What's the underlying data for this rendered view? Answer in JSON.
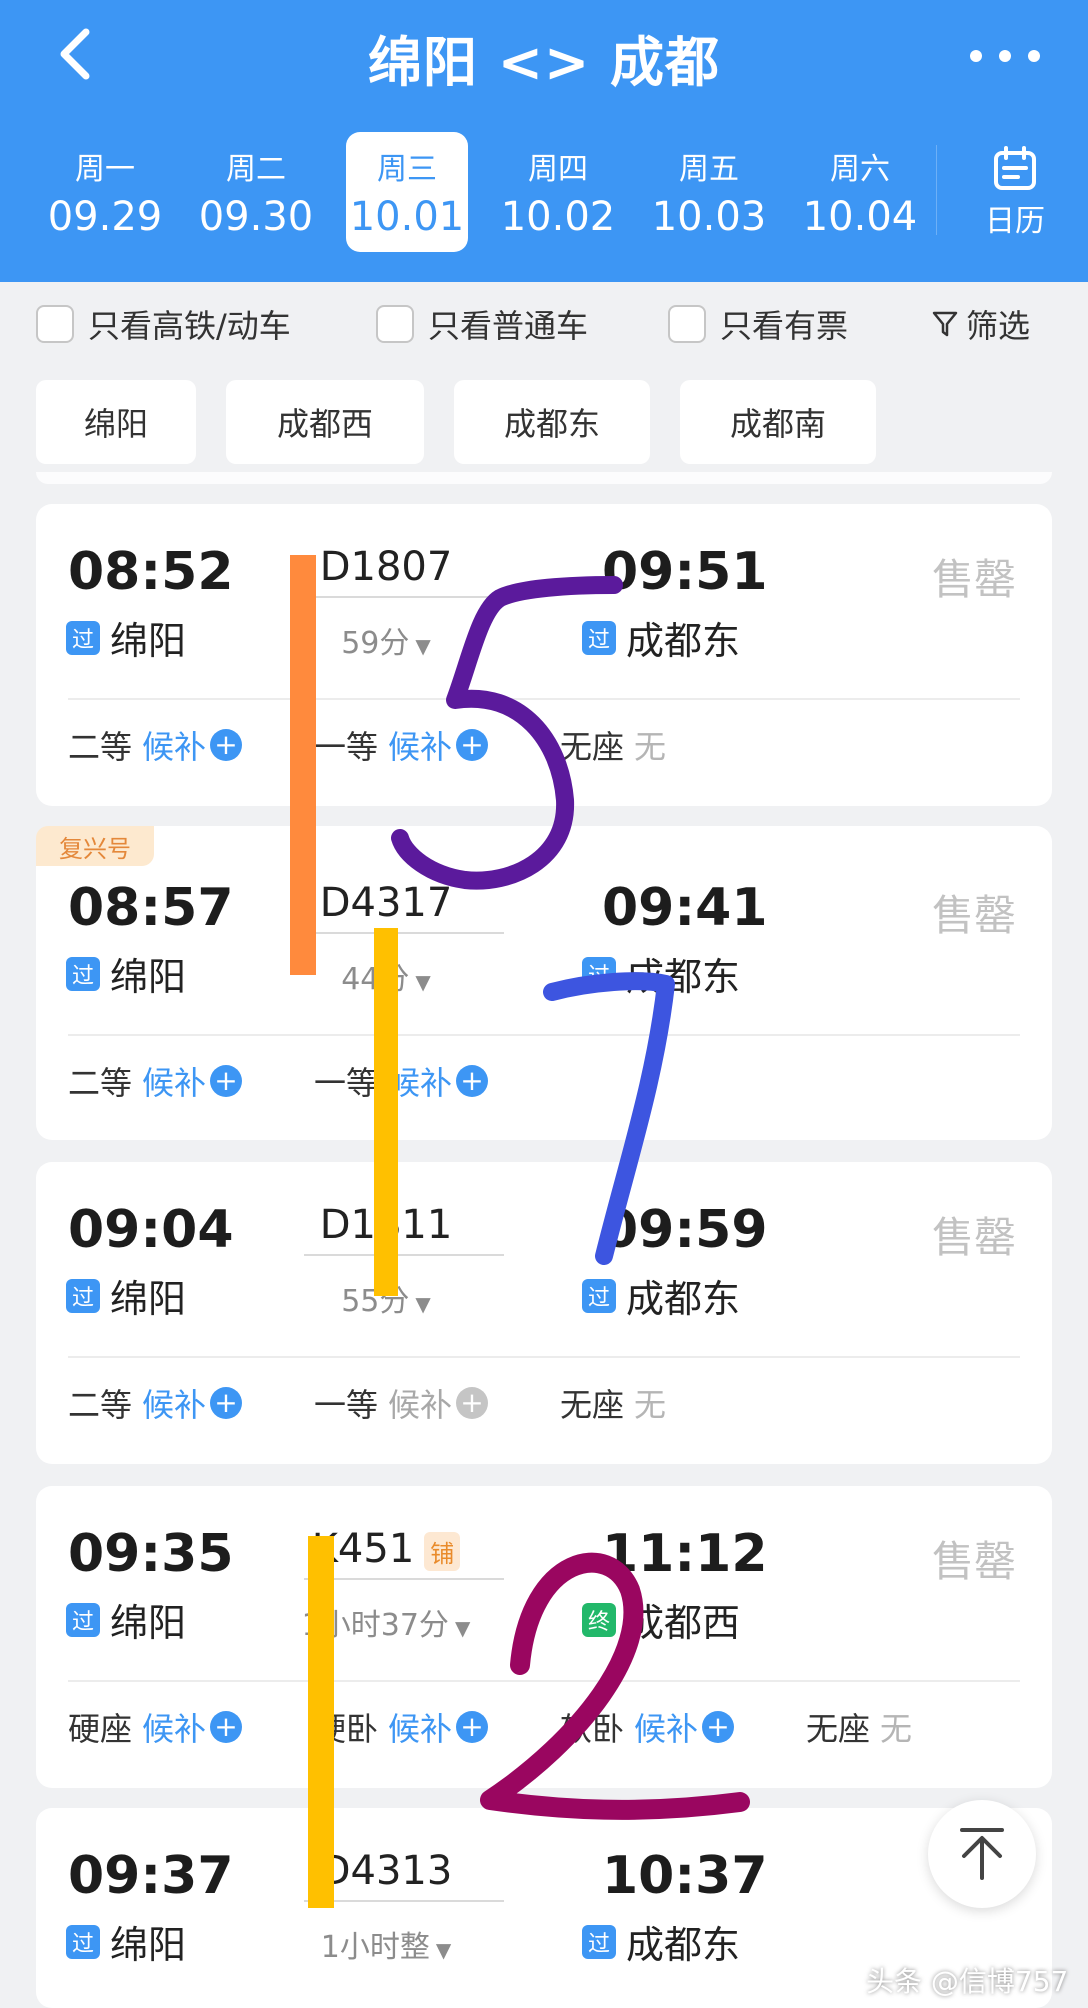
{
  "header": {
    "title": "绵阳 <> 成都",
    "tabs": [
      {
        "weekday": "周一",
        "date": "09.29"
      },
      {
        "weekday": "周二",
        "date": "09.30"
      },
      {
        "weekday": "周三",
        "date": "10.01"
      },
      {
        "weekday": "周四",
        "date": "10.02"
      },
      {
        "weekday": "周五",
        "date": "10.03"
      },
      {
        "weekday": "周六",
        "date": "10.04"
      }
    ],
    "calendar_label": "日历"
  },
  "filters": {
    "only_highspeed": "只看高铁/动车",
    "only_regular": "只看普通车",
    "only_available": "只看有票",
    "filter_label": "筛选"
  },
  "stations": [
    "绵阳",
    "成都西",
    "成都东",
    "成都南"
  ],
  "trains": [
    {
      "dep_time": "08:52",
      "dep_station": "绵阳",
      "dep_badge": "过",
      "train_no": "D1807",
      "duration": "59分",
      "arr_time": "09:51",
      "arr_station": "成都东",
      "arr_badge": "过",
      "status": "售罄",
      "seats": [
        {
          "name": "二等",
          "action": "候补"
        },
        {
          "name": "一等",
          "action": "候补"
        },
        {
          "name": "无座",
          "value": "无"
        }
      ]
    },
    {
      "tag": "复兴号",
      "dep_time": "08:57",
      "dep_station": "绵阳",
      "dep_badge": "过",
      "train_no": "D4317",
      "duration": "44分",
      "arr_time": "09:41",
      "arr_station": "成都东",
      "arr_badge": "过",
      "status": "售罄",
      "seats": [
        {
          "name": "二等",
          "action": "候补"
        },
        {
          "name": "一等",
          "action": "候补"
        }
      ]
    },
    {
      "dep_time": "09:04",
      "dep_station": "绵阳",
      "dep_badge": "过",
      "train_no": "D1811",
      "duration": "55分",
      "arr_time": "09:59",
      "arr_station": "成都东",
      "arr_badge": "过",
      "status": "售罄",
      "seats": [
        {
          "name": "二等",
          "action": "候补"
        },
        {
          "name": "一等",
          "action": "候补"
        },
        {
          "name": "无座",
          "value": "无"
        }
      ]
    },
    {
      "dep_time": "09:35",
      "dep_station": "绵阳",
      "dep_badge": "过",
      "train_no": "K451",
      "train_tag": "铺",
      "duration": "1小时37分",
      "arr_time": "11:12",
      "arr_station": "成都西",
      "arr_badge": "终",
      "status": "售罄",
      "seats": [
        {
          "name": "硬座",
          "action": "候补"
        },
        {
          "name": "硬卧",
          "action": "候补"
        },
        {
          "name": "软卧",
          "action": "候补"
        },
        {
          "name": "无座",
          "value": "无"
        }
      ]
    },
    {
      "dep_time": "09:37",
      "dep_station": "绵阳",
      "dep_badge": "过",
      "train_no": "D4313",
      "duration": "1小时整",
      "arr_time": "10:37",
      "arr_station": "成都东",
      "arr_badge": "过"
    }
  ],
  "annotations": [
    "5",
    "7",
    "2"
  ],
  "watermark": "头条 @信博757",
  "colors": {
    "primary": "#3d96f4",
    "sold_out": "#c2c2c2",
    "end_badge": "#22b86a"
  }
}
